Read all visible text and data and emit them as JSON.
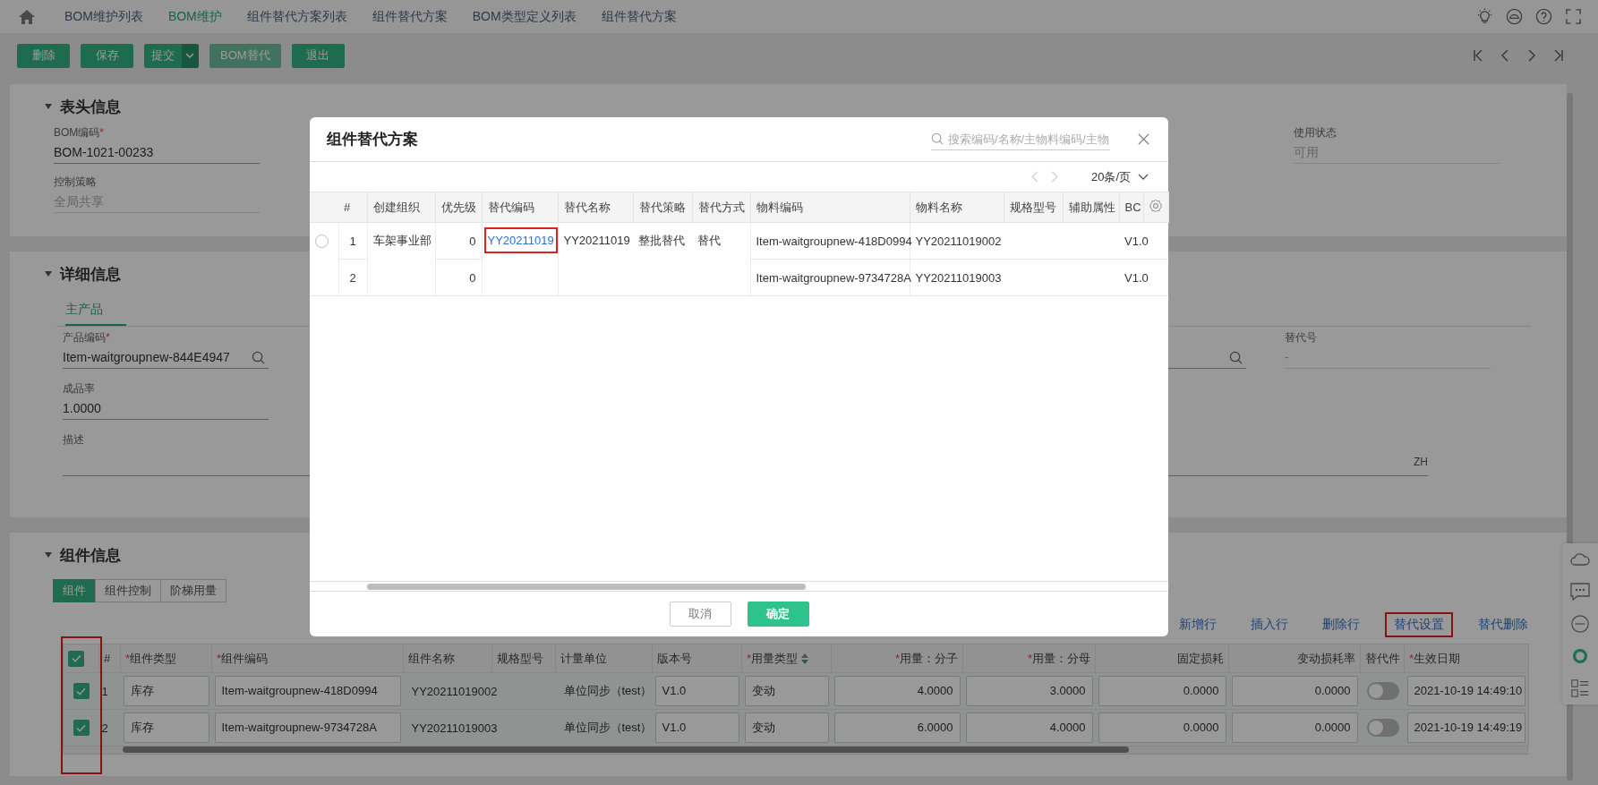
{
  "nav": {
    "tabs": [
      {
        "label": "BOM维护列表",
        "selected": false
      },
      {
        "label": "BOM维护",
        "selected": true
      },
      {
        "label": "组件替代方案列表",
        "selected": false
      },
      {
        "label": "组件替代方案",
        "selected": false
      },
      {
        "label": "BOM类型定义列表",
        "selected": false
      },
      {
        "label": "组件替代方案",
        "selected": false
      }
    ]
  },
  "toolbar": {
    "buttons": [
      {
        "label": "删除",
        "kind": "button",
        "disabled": false
      },
      {
        "label": "保存",
        "kind": "button",
        "disabled": false
      },
      {
        "label": "提交",
        "kind": "split",
        "disabled": false
      },
      {
        "label": "BOM替代",
        "kind": "button",
        "disabled": true
      },
      {
        "label": "退出",
        "kind": "button",
        "disabled": false
      }
    ]
  },
  "header_section": {
    "title": "表头信息",
    "expanded": true,
    "fields": [
      {
        "label": "BOM编码",
        "marker": "*",
        "value": "BOM-1021-00233",
        "readonly": false
      },
      {
        "label": "使用状态",
        "value": "可用",
        "readonly": true
      },
      {
        "label": "控制策略",
        "value": "全局共享",
        "readonly": true
      }
    ]
  },
  "detail_section": {
    "title": "详细信息",
    "expanded": true,
    "tabs": [
      {
        "label": "主产品",
        "selected": true
      }
    ],
    "fields": [
      {
        "kind": "lookup",
        "label": "产品编码",
        "marker": "*",
        "value": "Item-waitgroupnew-844E4947"
      },
      {
        "kind": "lookup"
      },
      {
        "kind": "plain",
        "label": "替代号",
        "value": "-",
        "readonly": true
      },
      {
        "kind": "plain",
        "label": "成品率",
        "value": "1.0000",
        "readonly": false
      },
      {
        "kind": "wide",
        "label": "描述",
        "language": "ZH"
      }
    ]
  },
  "component_section": {
    "title": "组件信息",
    "expanded": true,
    "tabs": [
      {
        "label": "组件",
        "selected": true
      },
      {
        "label": "组件控制",
        "selected": false
      },
      {
        "label": "阶梯用量",
        "selected": false
      }
    ],
    "actions": [
      {
        "label": "新增行",
        "highlighted": false
      },
      {
        "label": "插入行",
        "highlighted": false
      },
      {
        "label": "删除行",
        "highlighted": false
      },
      {
        "label": "替代设置",
        "highlighted": true
      },
      {
        "label": "替代删除",
        "highlighted": false
      }
    ],
    "select_all_checked": true,
    "checkbox_column_highlighted": true,
    "columns": [
      {
        "label": "#",
        "kind": "index"
      },
      {
        "label": "组件类型",
        "marker": "*",
        "kind": "input"
      },
      {
        "label": "组件编码",
        "marker": "*",
        "kind": "input"
      },
      {
        "label": "组件名称",
        "kind": "text"
      },
      {
        "label": "规格型号",
        "kind": "text"
      },
      {
        "label": "计量单位",
        "kind": "text"
      },
      {
        "label": "版本号",
        "kind": "input"
      },
      {
        "label": "用量类型",
        "marker": "*",
        "kind": "input",
        "sortable": true
      },
      {
        "label": "用量：分子",
        "marker": "*",
        "kind": "number"
      },
      {
        "label": "用量：分母",
        "marker": "*",
        "kind": "number"
      },
      {
        "label": "固定损耗",
        "kind": "number"
      },
      {
        "label": "变动损耗率",
        "kind": "number"
      },
      {
        "label": "替代件",
        "kind": "toggle"
      },
      {
        "label": "生效日期",
        "marker": "*",
        "kind": "input"
      }
    ],
    "rows": [
      {
        "checked": true,
        "cells": [
          "1",
          "库存",
          "Item-waitgroupnew-418D0994",
          "YY20211019002",
          null,
          "单位同步（test）",
          "V1.0",
          "变动",
          "4.0000",
          "3.0000",
          "0.0000",
          "0.0000",
          false,
          "2021-10-19 14:49:10"
        ]
      },
      {
        "checked": true,
        "cells": [
          "2",
          "库存",
          "Item-waitgroupnew-9734728A",
          "YY20211019003",
          null,
          "单位同步（test）",
          "V1.0",
          "变动",
          "6.0000",
          "4.0000",
          "0.0000",
          "0.0000",
          false,
          "2021-10-19 14:49:19"
        ]
      }
    ]
  },
  "modal": {
    "title": "组件替代方案",
    "search": {
      "placeholder": "搜索编码/名称/主物料编码/主物"
    },
    "pager": {
      "prev_disabled": true,
      "next_disabled": true,
      "page_size": "20条/页"
    },
    "columns": [
      "#",
      "创建组织",
      "优先级",
      "替代编码",
      "替代名称",
      "替代策略",
      "替代方式",
      "物料编码",
      "物料名称",
      "规格型号",
      "辅助属性",
      "BC"
    ],
    "groups": [
      {
        "selected": false,
        "org": "车架事业部",
        "code": "YY20211019",
        "code_highlighted": true,
        "name": "YY20211019",
        "strategy": "整批替代",
        "method": "替代",
        "items": [
          {
            "index": "1",
            "priority": "0",
            "material_code": "Item-waitgroupnew-418D0994",
            "material_name": "YY20211019002",
            "version": "V1.0"
          },
          {
            "index": "2",
            "priority": "0",
            "material_code": "Item-waitgroupnew-9734728A",
            "material_name": "YY20211019003",
            "version": "V1.0"
          }
        ]
      }
    ],
    "buttons": [
      {
        "label": "取消",
        "kind": "secondary"
      },
      {
        "label": "确定",
        "kind": "primary"
      }
    ]
  }
}
